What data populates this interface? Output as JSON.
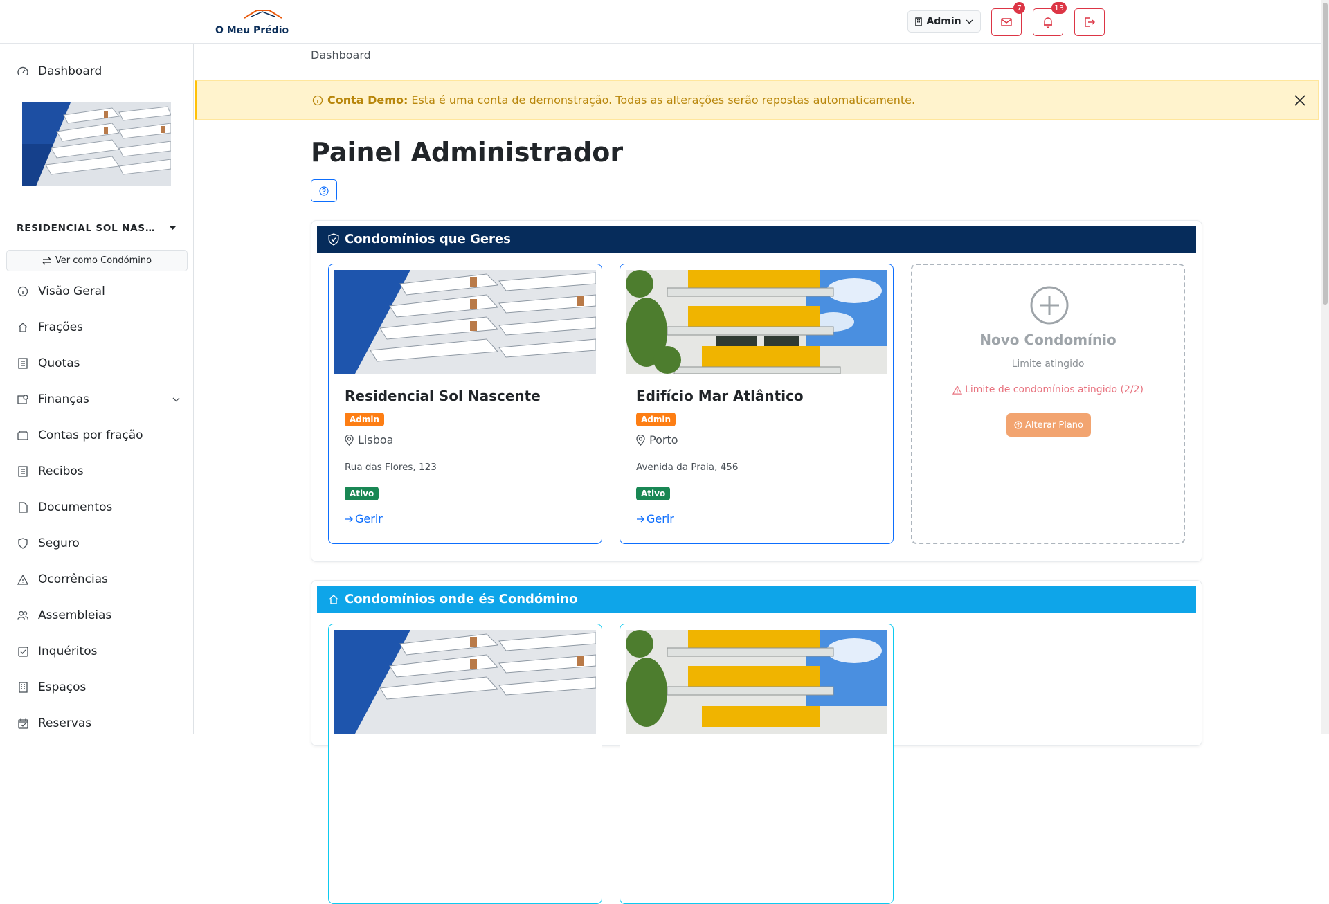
{
  "header": {
    "logo_text": "O Meu Prédio",
    "user_label": "Admin",
    "messages_count": "7",
    "notifications_count": "13"
  },
  "sidebar": {
    "dashboard_label": "Dashboard",
    "condo_name": "RESIDENCIAL SOL NASC...",
    "view_as_label": "Ver como Condómino",
    "items": [
      {
        "label": "Visão Geral",
        "icon": "info-icon"
      },
      {
        "label": "Frações",
        "icon": "home-icon"
      },
      {
        "label": "Quotas",
        "icon": "receipt-icon"
      },
      {
        "label": "Finanças",
        "icon": "finance-icon"
      },
      {
        "label": "Contas por fração",
        "icon": "wallet-icon"
      },
      {
        "label": "Recibos",
        "icon": "receipt-icon"
      },
      {
        "label": "Documentos",
        "icon": "file-icon"
      },
      {
        "label": "Seguro",
        "icon": "shield-icon"
      },
      {
        "label": "Ocorrências",
        "icon": "warning-icon"
      },
      {
        "label": "Assembleias",
        "icon": "people-icon"
      },
      {
        "label": "Inquéritos",
        "icon": "checkbox-icon"
      },
      {
        "label": "Espaços",
        "icon": "building-icon"
      },
      {
        "label": "Reservas",
        "icon": "calendar-icon"
      }
    ]
  },
  "main": {
    "breadcrumb": "Dashboard",
    "alert": {
      "strong": "Conta Demo:",
      "text": "Esta é uma conta de demonstração. Todas as alterações serão repostas automaticamente."
    },
    "title": "Painel Administrador",
    "managed_section": {
      "title": "Condomínios que Geres",
      "color": "#062c5b",
      "cards": [
        {
          "name": "Residencial Sol Nascente",
          "role": "Admin",
          "city": "Lisboa",
          "address": "Rua das Flores, 123",
          "status": "Ativo",
          "link": "Gerir"
        },
        {
          "name": "Edifício Mar Atlântico",
          "role": "Admin",
          "city": "Porto",
          "address": "Avenida da Praia, 456",
          "status": "Ativo",
          "link": "Gerir"
        }
      ],
      "new_card": {
        "title": "Novo Condomínio",
        "subtitle": "Limite atingido",
        "warning": "Limite de condomínios atingido (2/2)",
        "button": "Alterar Plano"
      }
    },
    "owner_section": {
      "title": "Condomínios onde és Condómino",
      "color": "#0ea5e9"
    }
  },
  "colors": {
    "admin_badge": "#fd7e14",
    "active_badge": "#198754",
    "link": "#0d6efd",
    "danger": "#dc3545"
  }
}
